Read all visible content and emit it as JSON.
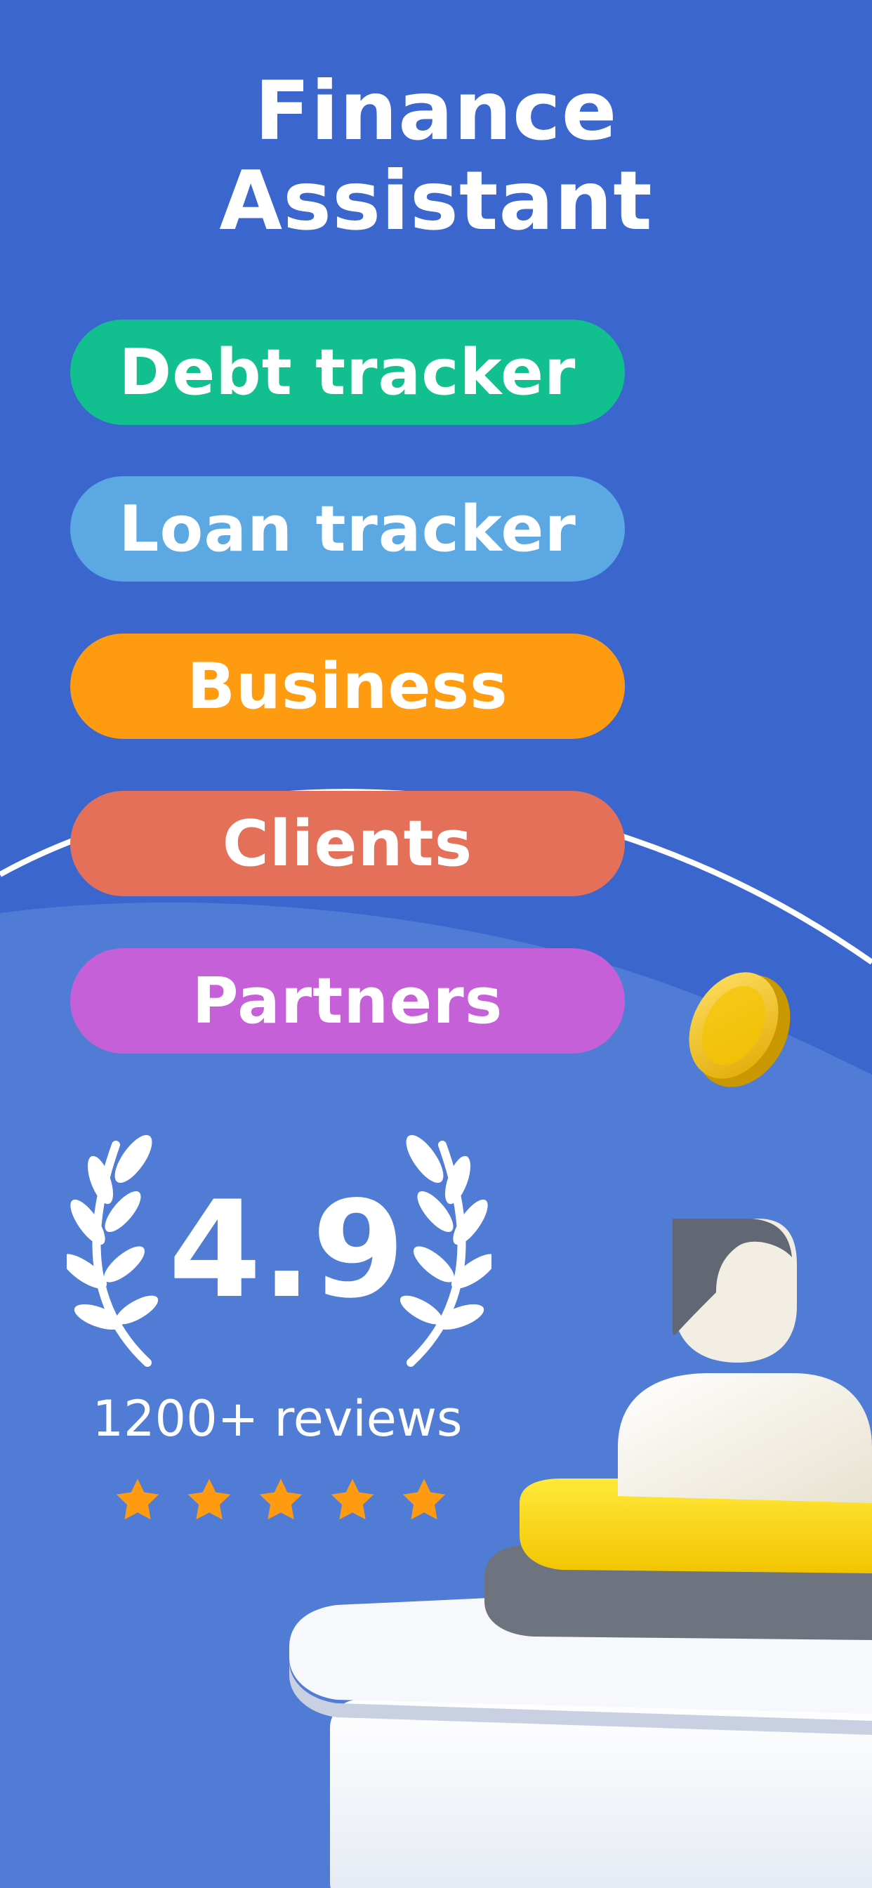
{
  "title": {
    "line1": "Finance",
    "line2": "Assistant"
  },
  "features": [
    {
      "label": "Debt tracker",
      "color": "#12BF8E"
    },
    {
      "label": "Loan tracker",
      "color": "#5BA8E3"
    },
    {
      "label": "Business",
      "color": "#FF9B10"
    },
    {
      "label": "Clients",
      "color": "#E5705A"
    },
    {
      "label": "Partners",
      "color": "#C660D8"
    }
  ],
  "rating": {
    "value": "4.9",
    "reviews": "1200+ reviews",
    "stars": 5,
    "star_color": "#FF9B10"
  },
  "colors": {
    "background": "#3A66CE",
    "text": "#FFFFFF"
  }
}
